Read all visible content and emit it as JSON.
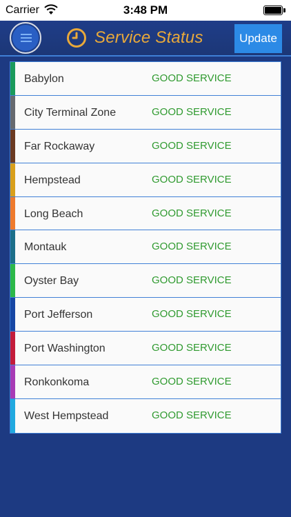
{
  "status_bar": {
    "carrier": "Carrier",
    "time": "3:48 PM"
  },
  "header": {
    "title": "Service Status",
    "update_label": "Update",
    "menu_icon": "hamburger-icon",
    "clock_icon": "clock-icon",
    "title_color": "#e9a93a",
    "accent_color": "#2c8ae6"
  },
  "branches": [
    {
      "name": "Babylon",
      "status": "GOOD SERVICE",
      "color": "#1a9a5c"
    },
    {
      "name": "City Terminal Zone",
      "status": "GOOD SERVICE",
      "color": "#666a70"
    },
    {
      "name": "Far Rockaway",
      "status": "GOOD SERVICE",
      "color": "#6b3a22"
    },
    {
      "name": "Hempstead",
      "status": "GOOD SERVICE",
      "color": "#d89f1c"
    },
    {
      "name": "Long Beach",
      "status": "GOOD SERVICE",
      "color": "#ee7a2d"
    },
    {
      "name": "Montauk",
      "status": "GOOD SERVICE",
      "color": "#1c6f8a"
    },
    {
      "name": "Oyster Bay",
      "status": "GOOD SERVICE",
      "color": "#2cb84a"
    },
    {
      "name": "Port Jefferson",
      "status": "GOOD SERVICE",
      "color": "#1747a4"
    },
    {
      "name": "Port Washington",
      "status": "GOOD SERVICE",
      "color": "#c31c3b"
    },
    {
      "name": "Ronkonkoma",
      "status": "GOOD SERVICE",
      "color": "#a73bb5"
    },
    {
      "name": "West Hempstead",
      "status": "GOOD SERVICE",
      "color": "#21a9e0"
    }
  ]
}
